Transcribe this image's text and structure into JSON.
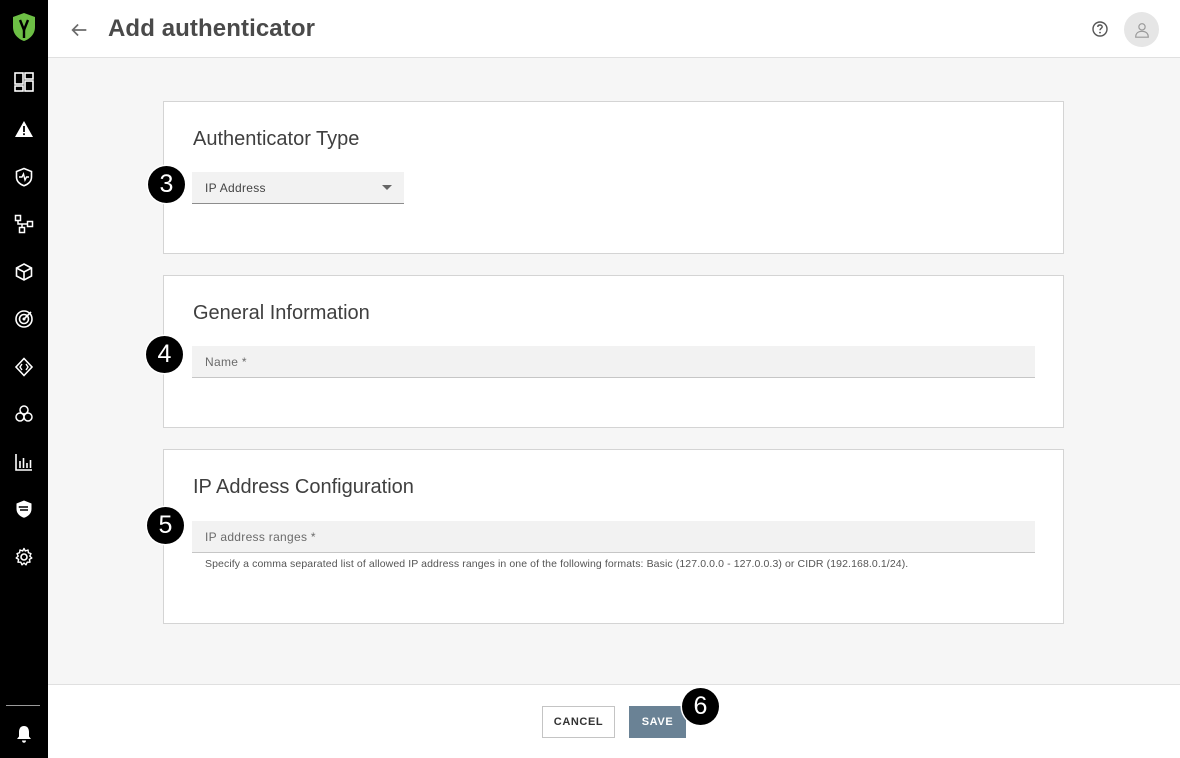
{
  "app": {
    "accent_color": "#6DBF45",
    "sidebar_color": "#000000"
  },
  "sidebar": {
    "logo": "product-logo-icon",
    "items": [
      {
        "icon": "dashboard-icon"
      },
      {
        "icon": "alert-icon"
      },
      {
        "icon": "shield-health-icon"
      },
      {
        "icon": "network-topology-icon"
      },
      {
        "icon": "box-icon"
      },
      {
        "icon": "radar-icon"
      },
      {
        "icon": "api-code-icon"
      },
      {
        "icon": "integrations-icon"
      },
      {
        "icon": "analytics-chart-icon"
      },
      {
        "icon": "policy-shield-icon"
      },
      {
        "icon": "gear-icon"
      }
    ],
    "bottom_item": {
      "icon": "bell-icon"
    }
  },
  "header": {
    "title": "Add authenticator",
    "back_icon": "arrow-left-icon",
    "help_icon": "help-circle-icon",
    "avatar_icon": "user-icon"
  },
  "cards": {
    "type": {
      "title": "Authenticator Type",
      "select_value": "IP Address",
      "step": "3"
    },
    "general": {
      "title": "General Information",
      "name_placeholder": "Name *",
      "step": "4"
    },
    "ip_config": {
      "title": "IP Address Configuration",
      "ranges_placeholder": "IP address ranges *",
      "helper": "Specify a comma separated list of allowed IP address ranges in one of the following formats: Basic (127.0.0.0 - 127.0.0.3) or CIDR (192.168.0.1/24).",
      "step": "5"
    }
  },
  "footer": {
    "cancel_label": "CANCEL",
    "save_label": "SAVE",
    "step": "6",
    "save_color": "#6A8295"
  }
}
